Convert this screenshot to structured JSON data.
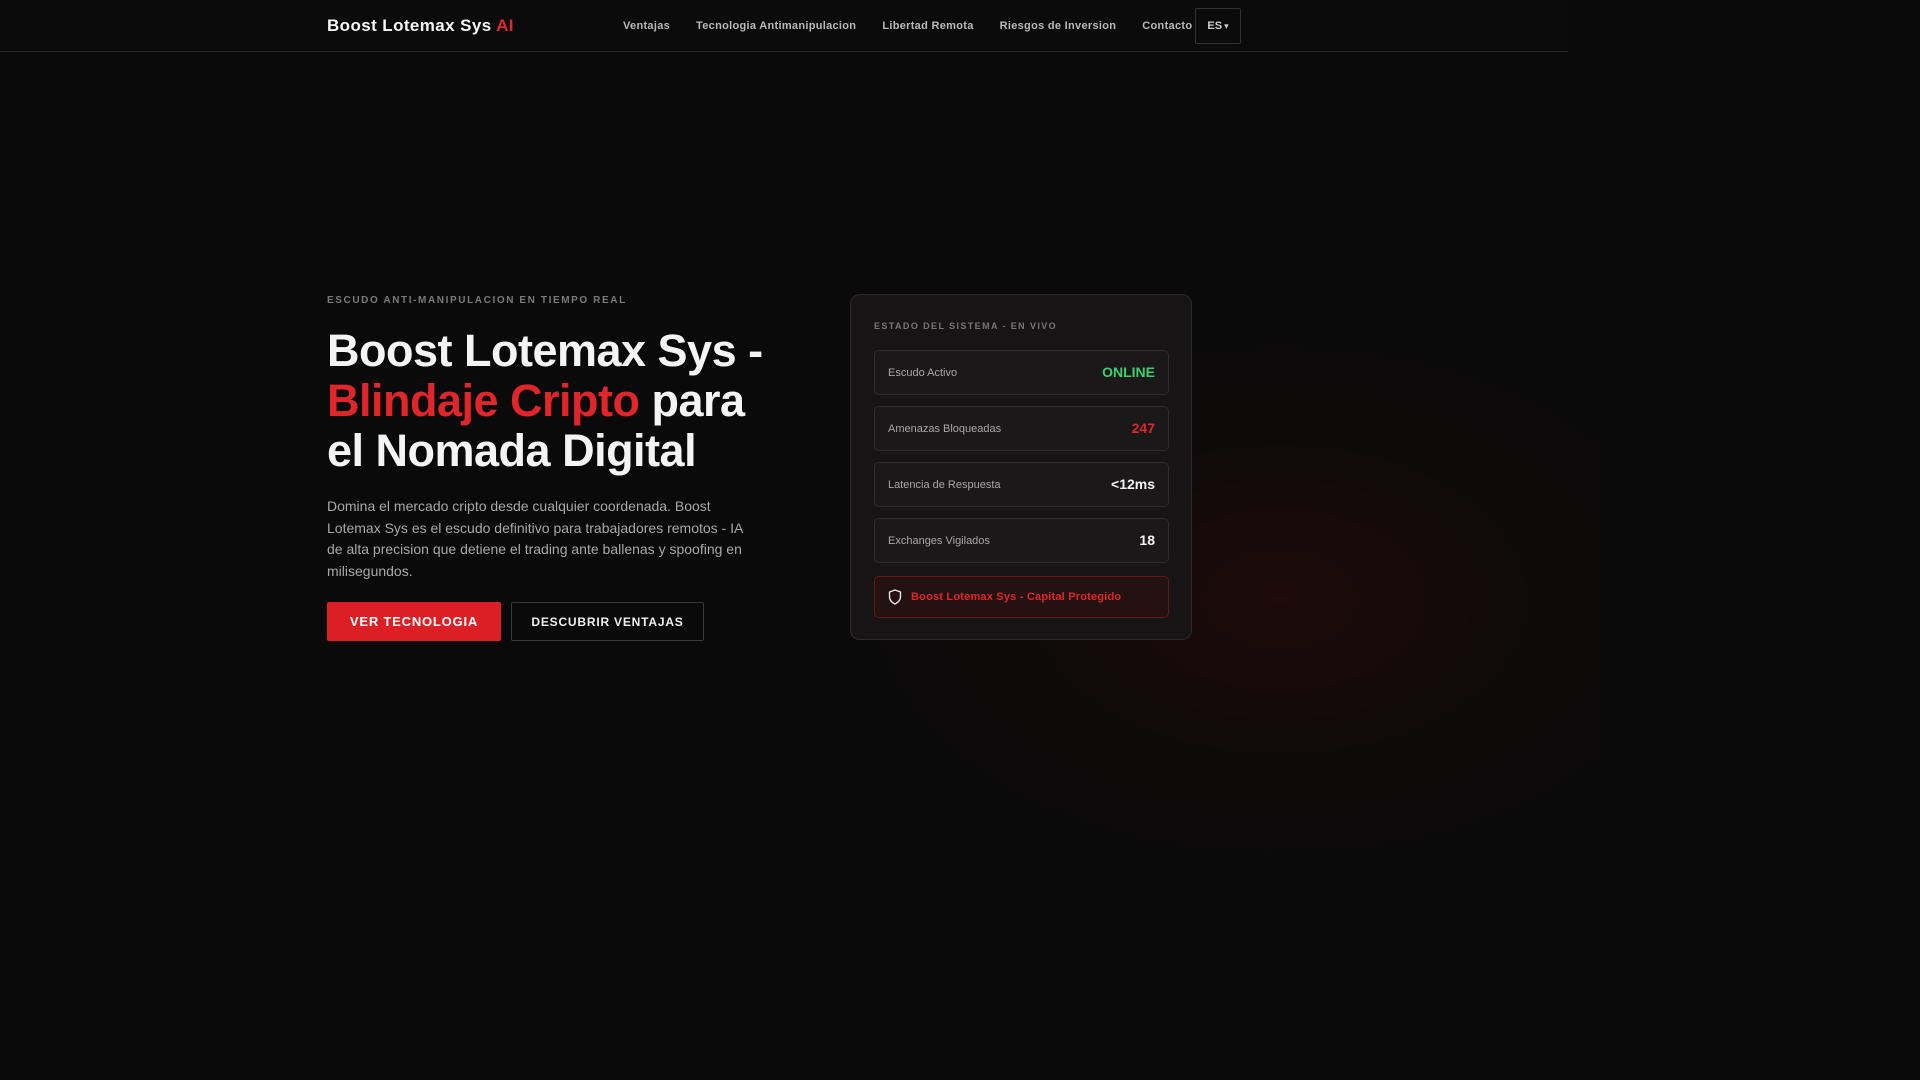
{
  "header": {
    "logo_main": "Boost Lotemax Sys",
    "logo_accent": "AI",
    "nav": [
      {
        "label": "Ventajas"
      },
      {
        "label": "Tecnologia Antimanipulacion"
      },
      {
        "label": "Libertad Remota"
      },
      {
        "label": "Riesgos de Inversion"
      },
      {
        "label": "Contacto"
      }
    ],
    "lang": "ES",
    "lang_caret": "▾"
  },
  "hero": {
    "eyebrow": "ESCUDO ANTI-MANIPULACION EN TIEMPO REAL",
    "title_part1": "Boost Lotemax Sys - ",
    "title_highlight": "Blindaje Cripto",
    "title_part2": " para el Nomada Digital",
    "description": "Domina el mercado cripto desde cualquier coordenada. Boost Lotemax Sys es el escudo definitivo para trabajadores remotos - IA de alta precision que detiene el trading ante ballenas y spoofing en milisegundos.",
    "primary_button": "VER TECNOLOGIA",
    "secondary_button": "DESCUBRIR VENTAJAS"
  },
  "status_card": {
    "title": "ESTADO DEL SISTEMA - EN VIVO",
    "stats": [
      {
        "label": "Escudo Activo",
        "value": "ONLINE",
        "color": "#3ecf6e"
      },
      {
        "label": "Amenazas Bloqueadas",
        "value": "247",
        "color": "#e0262a"
      },
      {
        "label": "Latencia de Respuesta",
        "value": "<12ms",
        "color": "#f2f2f2"
      },
      {
        "label": "Exchanges Vigilados",
        "value": "18",
        "color": "#f2f2f2"
      }
    ],
    "banner_icon": "shield-icon",
    "banner_text": "Boost Lotemax Sys - Capital Protegido"
  },
  "colors": {
    "accent": "#e0262a",
    "background": "#0a0a0a",
    "online": "#3ecf6e"
  }
}
